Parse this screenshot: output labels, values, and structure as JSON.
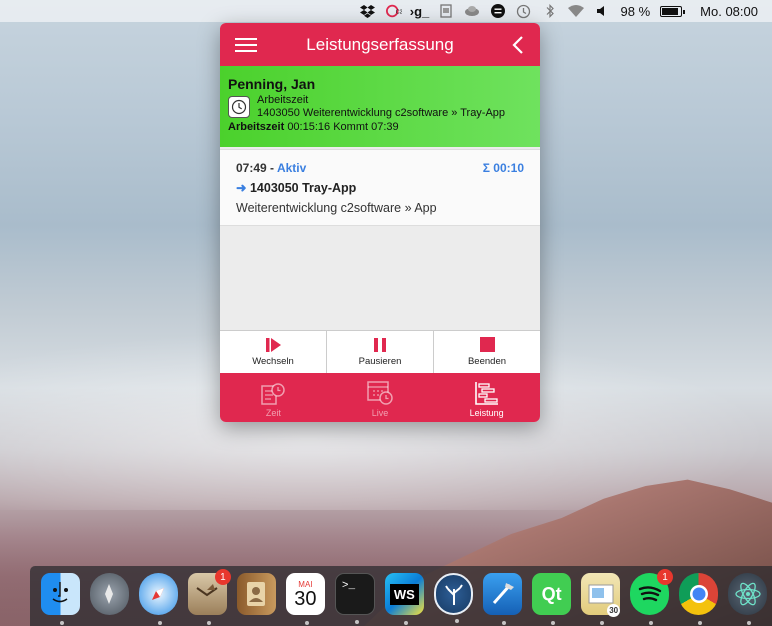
{
  "menubar": {
    "icons": [
      "dropbox-icon",
      "c2-icon",
      "g-icon",
      "screenshot-icon",
      "cloud-icon",
      "menu-icon",
      "time-machine-icon",
      "bluetooth-icon",
      "wifi-icon",
      "volume-icon"
    ],
    "battery_percent": "98 %",
    "battery_level": 0.98,
    "clock": "Mo. 08:00"
  },
  "window": {
    "title": "Leistungserfassung",
    "active_entry": {
      "name": "Penning, Jan",
      "type": "Arbeitszeit",
      "project": "1403050 Weiterentwicklung c2software » Tray-App",
      "stat_label": "Arbeitszeit",
      "stat_duration": "00:15:16",
      "stat_come_label": "Kommt",
      "stat_come_time": "07:39"
    },
    "card": {
      "time": "07:49",
      "separator": "-",
      "status": "Aktiv",
      "sum_symbol": "Σ",
      "sum": "00:10",
      "project": "1403050 Tray-App",
      "description": "Weiterentwicklung c2software » App"
    },
    "actions": [
      {
        "label": "Wechseln",
        "icon": "switch-icon"
      },
      {
        "label": "Pausieren",
        "icon": "pause-icon"
      },
      {
        "label": "Beenden",
        "icon": "stop-icon"
      }
    ],
    "tabs": [
      {
        "label": "Zeit",
        "icon": "time-list-icon",
        "active": false
      },
      {
        "label": "Live",
        "icon": "calendar-clock-icon",
        "active": false
      },
      {
        "label": "Leistung",
        "icon": "gantt-icon",
        "active": true
      }
    ],
    "colors": {
      "accent": "#e0284f",
      "active_green": "#4bd12c",
      "link_blue": "#3a7fe0"
    }
  },
  "dock": {
    "apps": [
      {
        "name": "finder-icon"
      },
      {
        "name": "launchpad-icon"
      },
      {
        "name": "safari-icon"
      },
      {
        "name": "mail-icon",
        "badge": "1"
      },
      {
        "name": "contacts-icon"
      },
      {
        "name": "calendar-icon",
        "month": "MAI",
        "day": "30"
      },
      {
        "name": "terminal-icon",
        "text": ">_"
      },
      {
        "name": "webstorm-icon",
        "text": "WS"
      },
      {
        "name": "sourcetree-icon"
      },
      {
        "name": "xcode-icon"
      },
      {
        "name": "qt-creator-icon",
        "text": "Qt"
      },
      {
        "name": "preview-icon",
        "text": "30"
      },
      {
        "name": "spotify-icon",
        "badge": "1"
      },
      {
        "name": "chrome-icon"
      },
      {
        "name": "atom-icon"
      }
    ]
  }
}
